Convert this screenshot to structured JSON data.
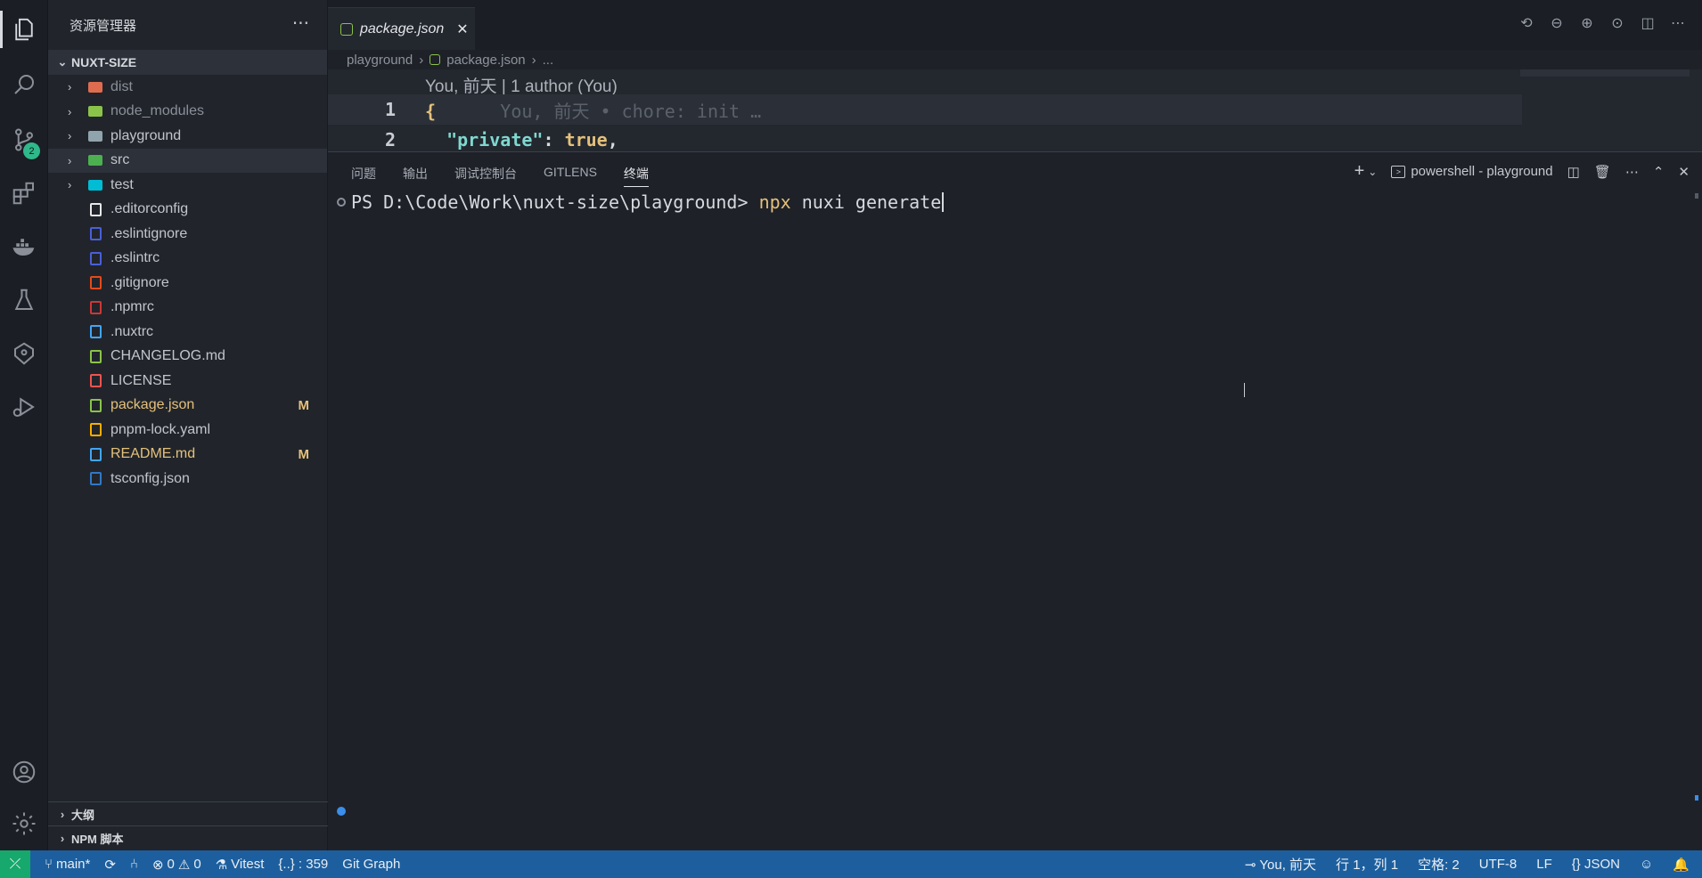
{
  "sidebar": {
    "title": "资源管理器",
    "more": "···",
    "root": "NUXT-SIZE",
    "items": [
      {
        "label": "dist",
        "icon": "folder-dist-icon",
        "color": "#e06c50",
        "folder": true
      },
      {
        "label": "node_modules",
        "icon": "folder-node-icon",
        "color": "#8bc34a",
        "folder": true
      },
      {
        "label": "playground",
        "icon": "folder-icon",
        "color": "#90a4ae",
        "folder": true
      },
      {
        "label": "src",
        "icon": "folder-src-icon",
        "color": "#4caf50",
        "folder": true
      },
      {
        "label": "test",
        "icon": "folder-test-icon",
        "color": "#00bcd4",
        "folder": true
      },
      {
        "label": ".editorconfig",
        "icon": "editorconfig-icon",
        "color": "#e8e8e8"
      },
      {
        "label": ".eslintignore",
        "icon": "eslint-icon",
        "color": "#4b5fd8"
      },
      {
        "label": ".eslintrc",
        "icon": "eslint-icon",
        "color": "#4b5fd8"
      },
      {
        "label": ".gitignore",
        "icon": "git-icon",
        "color": "#e64a19"
      },
      {
        "label": ".npmrc",
        "icon": "npm-icon",
        "color": "#cb3837"
      },
      {
        "label": ".nuxtrc",
        "icon": "file-icon",
        "color": "#42a5f5"
      },
      {
        "label": "CHANGELOG.md",
        "icon": "changelog-icon",
        "color": "#8bc34a"
      },
      {
        "label": "LICENSE",
        "icon": "license-icon",
        "color": "#ef5350"
      },
      {
        "label": "package.json",
        "icon": "nodejs-icon",
        "color": "#8bc34a",
        "modified": "M"
      },
      {
        "label": "pnpm-lock.yaml",
        "icon": "pnpm-icon",
        "color": "#f9ad00"
      },
      {
        "label": "README.md",
        "icon": "info-icon",
        "color": "#42a5f5",
        "modified": "M"
      },
      {
        "label": "tsconfig.json",
        "icon": "tsconfig-icon",
        "color": "#3178c6"
      }
    ],
    "outline": "大纲",
    "npm_scripts": "NPM 脚本"
  },
  "activity": {
    "scm_badge": "2"
  },
  "editor": {
    "tab_label": "package.json",
    "breadcrumb": [
      "playground",
      "package.json",
      "..."
    ],
    "blame_header": "You, 前天 | 1 author (You)",
    "lines": [
      {
        "num": "1",
        "code": "{",
        "ghost": "      You, 前天 • chore: init …"
      },
      {
        "num": "2",
        "key": "\"private\"",
        "sep": ": ",
        "val": "true",
        "end": ","
      }
    ]
  },
  "panel": {
    "tabs": [
      "问题",
      "输出",
      "调试控制台",
      "GITLENS",
      "终端"
    ],
    "active_tab": "终端",
    "terminal_name": "powershell - playground",
    "prompt": "PS D:\\Code\\Work\\nuxt-size\\playground> ",
    "command": "npx",
    "args": " nuxi generate"
  },
  "status": {
    "branch": "main*",
    "errors": "0",
    "warnings": "0",
    "vitest": "Vitest",
    "json_count": "{..} : 359",
    "git_graph": "Git Graph",
    "blame": "You, 前天",
    "position": "行 1，列 1",
    "spaces": "空格: 2",
    "encoding": "UTF-8",
    "eol": "LF",
    "language": "{} JSON"
  }
}
